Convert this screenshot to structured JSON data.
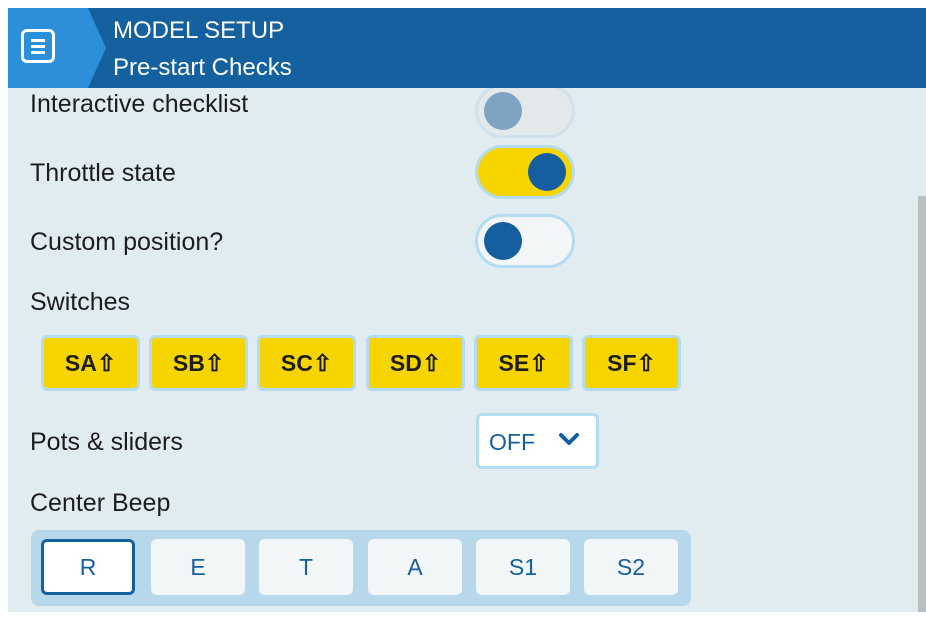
{
  "header": {
    "title": "MODEL SETUP",
    "subtitle": "Pre-start Checks",
    "menu_icon": "menu-list-icon"
  },
  "rows": {
    "interactive_checklist": {
      "label": "Interactive checklist",
      "state": "off"
    },
    "throttle_state": {
      "label": "Throttle state",
      "state": "on"
    },
    "custom_position": {
      "label": "Custom position?",
      "state": "off"
    },
    "switches": {
      "label": "Switches",
      "items": [
        "SA⇧",
        "SB⇧",
        "SC⇧",
        "SD⇧",
        "SE⇧",
        "SF⇧"
      ]
    },
    "pots_sliders": {
      "label": "Pots & sliders",
      "value": "OFF"
    },
    "center_beep": {
      "label": "Center Beep",
      "items": [
        "R",
        "E",
        "T",
        "A",
        "S1",
        "S2"
      ],
      "focused": "R"
    }
  },
  "colors": {
    "header": "#1561a0",
    "accent": "#2b8fd9",
    "background": "#e1ecf1",
    "toggle_on": "#f6d400",
    "knob": "#155ea0"
  }
}
